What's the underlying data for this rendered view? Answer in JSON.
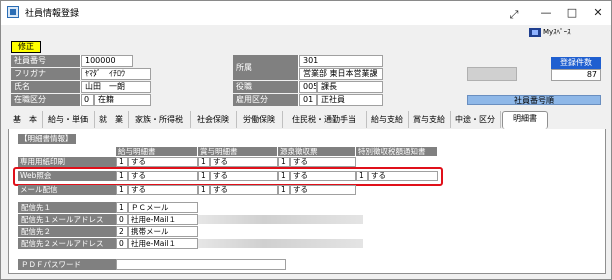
{
  "window": {
    "title": "社員情報登録",
    "minimize_glyph": "—",
    "maximize_glyph": "□",
    "close_glyph": "✕",
    "expand_icon": "⤢",
    "myspace_label": "Myｽﾍﾟｰｽ"
  },
  "mode_badge": "修正",
  "employee": {
    "fields": [
      {
        "label": "社員番号",
        "value": "100000"
      },
      {
        "label": "フリガナ",
        "value": "ﾔﾏﾀﾞ　ｲﾁﾛｳ"
      },
      {
        "label": "氏名",
        "value": "山田　一朗"
      },
      {
        "label": "在職区分",
        "code": "0",
        "value": "在籍"
      }
    ],
    "affiliation_label": "所属",
    "affiliation_code": "301",
    "affiliation_name": "営業部 東日本営業課",
    "position_label": "役職",
    "position_code": "005",
    "position_name": "課長",
    "employment_label": "雇用区分",
    "employment_code": "01",
    "employment_name": "正社員"
  },
  "summary": {
    "count_label": "登録件数",
    "count_value": "87",
    "sort_label": "社員番号順"
  },
  "tabs": [
    "基　本",
    "給与・単価",
    "就　業",
    "家族・所得税",
    "社会保険",
    "労働保険",
    "住民税・通勤手当",
    "給与支給",
    "賞与支給",
    "中途・区分",
    "明細書"
  ],
  "active_tab": "明細書",
  "detail": {
    "section_title": "【明細書情報】",
    "columns": [
      "給与明細書",
      "賞与明細書",
      "源泉徴収票",
      "特別徴収税額通知書"
    ],
    "rows": [
      {
        "label": "専用用紙印刷",
        "cells": [
          {
            "code": "1",
            "text": "する"
          },
          {
            "code": "1",
            "text": "する"
          },
          {
            "code": "1",
            "text": "する"
          },
          {
            "code": "",
            "text": ""
          }
        ]
      },
      {
        "label": "Web照会",
        "cells": [
          {
            "code": "1",
            "text": "する"
          },
          {
            "code": "1",
            "text": "する"
          },
          {
            "code": "1",
            "text": "する"
          },
          {
            "code": "1",
            "text": "する"
          }
        ]
      },
      {
        "label": "メール配信",
        "cells": [
          {
            "code": "1",
            "text": "する"
          },
          {
            "code": "1",
            "text": "する"
          },
          {
            "code": "1",
            "text": "する"
          },
          {
            "code": "",
            "text": ""
          }
        ]
      }
    ]
  },
  "delivery": [
    {
      "label": "配信先１",
      "code": "1",
      "value": "ＰＣメール"
    },
    {
      "label": "配信先１メールアドレス",
      "code": "0",
      "value": "社用e-Mail１"
    },
    {
      "label": "配信先２",
      "code": "2",
      "value": "携帯メール"
    },
    {
      "label": "配信先２メールアドレス",
      "code": "0",
      "value": "社用e-Mail１"
    }
  ],
  "pdf_password_label": "ＰＤＦパスワード",
  "colors": {
    "badge_yellow": "#ffff00",
    "label_gray": "#808080",
    "count_blue": "#1f5fd0",
    "sort_bar_blue": "#8fb8e8",
    "highlight_red": "#e0101a"
  }
}
